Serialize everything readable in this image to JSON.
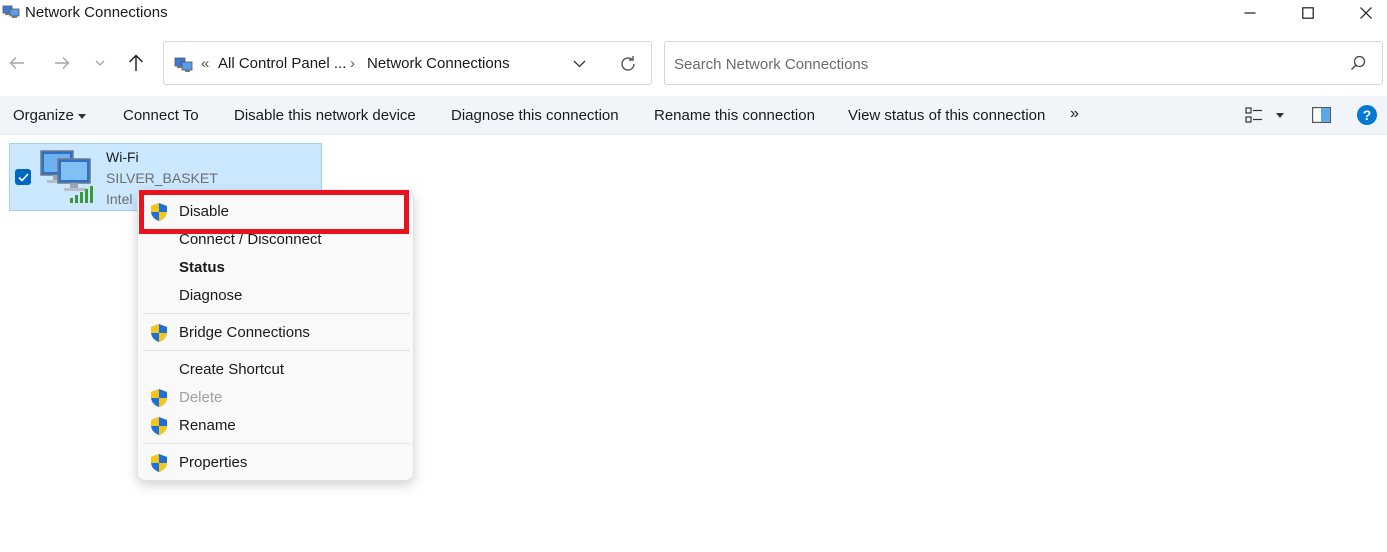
{
  "window": {
    "title": "Network Connections"
  },
  "address": {
    "overflow": "«",
    "segments": [
      "All Control Panel ...",
      "Network Connections"
    ],
    "separator": "›"
  },
  "search": {
    "placeholder": "Search Network Connections"
  },
  "commandbar": {
    "organize": "Organize",
    "connect_to": "Connect To",
    "disable_device": "Disable this network device",
    "diagnose": "Diagnose this connection",
    "rename": "Rename this connection",
    "view_status": "View status of this connection",
    "more": "»"
  },
  "connection": {
    "name": "Wi-Fi",
    "network": "SILVER_BASKET",
    "adapter": "Intel"
  },
  "context_menu": {
    "items": [
      {
        "label": "Disable",
        "shield": true,
        "bold": false,
        "disabled": false
      },
      {
        "label": "Connect / Disconnect",
        "shield": false,
        "bold": false,
        "disabled": false
      },
      {
        "label": "Status",
        "shield": false,
        "bold": true,
        "disabled": false
      },
      {
        "label": "Diagnose",
        "shield": false,
        "bold": false,
        "disabled": false
      },
      {
        "label": "Bridge Connections",
        "shield": true,
        "bold": false,
        "disabled": false
      },
      {
        "label": "Create Shortcut",
        "shield": false,
        "bold": false,
        "disabled": false
      },
      {
        "label": "Delete",
        "shield": true,
        "bold": false,
        "disabled": true
      },
      {
        "label": "Rename",
        "shield": true,
        "bold": false,
        "disabled": false
      },
      {
        "label": "Properties",
        "shield": true,
        "bold": false,
        "disabled": false
      }
    ],
    "highlighted_item": "Disable"
  },
  "colors": {
    "accent": "#0067c0",
    "selection_bg": "#cce8ff",
    "highlight_box": "#e8131f",
    "commandbar_bg": "#f1f5fa",
    "help_icon": "#0078d4"
  }
}
